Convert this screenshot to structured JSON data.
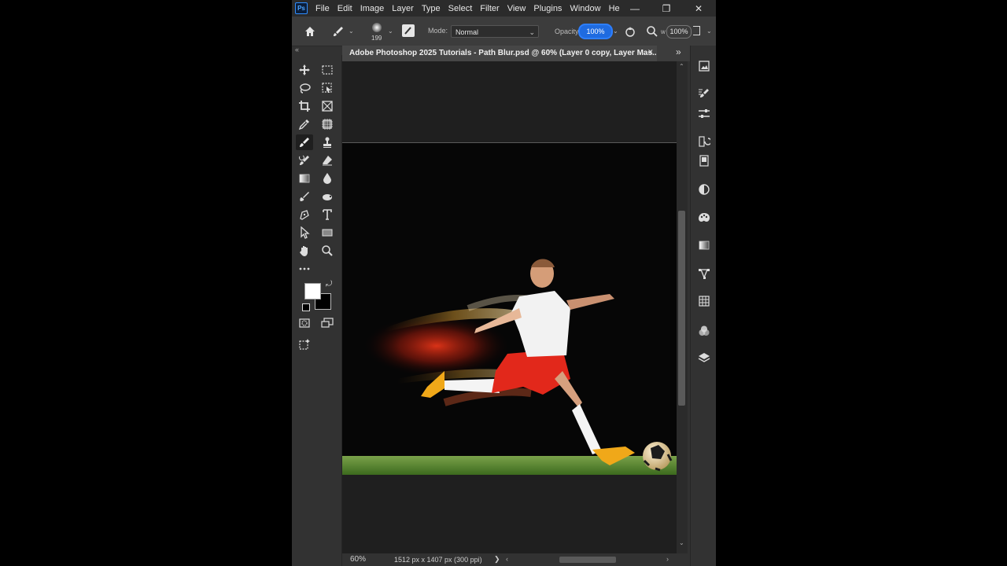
{
  "menu": {
    "logo": "Ps",
    "items": [
      "File",
      "Edit",
      "Image",
      "Layer",
      "Type",
      "Select",
      "Filter",
      "View",
      "Plugins",
      "Window",
      "He"
    ]
  },
  "window_controls": {
    "minimize": "—",
    "restore": "❐",
    "close": "✕"
  },
  "options": {
    "brush_size": "199",
    "mode_label": "Mode:",
    "mode_value": "Normal",
    "opacity_label": "Opacity:",
    "opacity_value": "100%",
    "flow_label": "w",
    "flow_value": "100%"
  },
  "document": {
    "tab_title": "Adobe Photoshop 2025 Tutorials - Path Blur.psd @ 60% (Layer 0 copy, Layer Mas...",
    "close": "✕"
  },
  "status": {
    "zoom": "60%",
    "dimensions": "1512 px x 1407 px (300 ppi)",
    "arrow": "❯"
  },
  "colors": {
    "foreground": "#ffffff",
    "background": "#000000",
    "accent": "#2d7fff"
  },
  "right_panel_icons": [
    "libraries-icon",
    "brush-settings-icon",
    "properties-icon",
    "history-icon",
    "clone-source-icon",
    "adjustments-icon",
    "color-icon",
    "gradients-icon",
    "paths-icon",
    "table-icon",
    "channels-icon",
    "layers-icon"
  ]
}
